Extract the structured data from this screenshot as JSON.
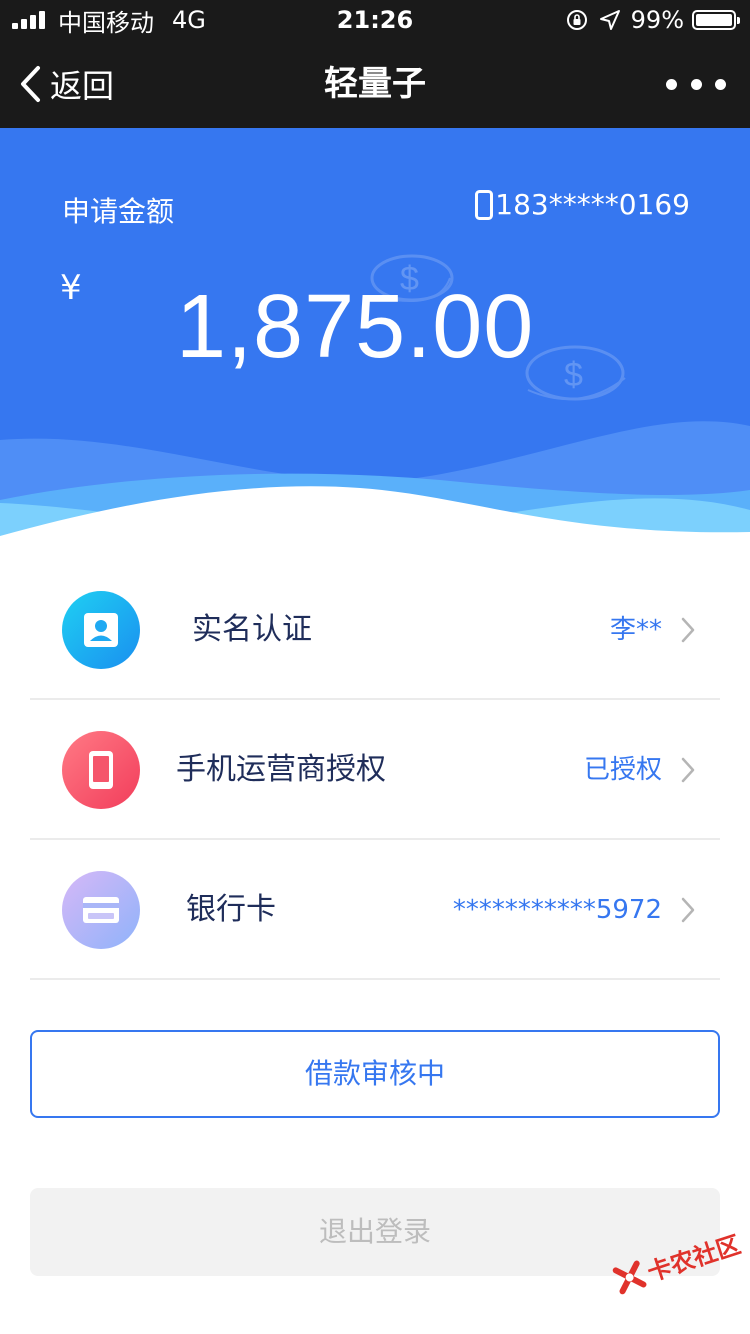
{
  "status_bar": {
    "carrier": "中国移动",
    "network": "4G",
    "time": "21:26",
    "battery": "99%",
    "battery_level": 0.99
  },
  "nav": {
    "back_label": "返回",
    "title": "轻量子"
  },
  "hero": {
    "label": "申请金额",
    "phone": "183*****0169",
    "currency": "¥",
    "amount": "1,875.00",
    "background_color": "#3677f0"
  },
  "list": {
    "items": [
      {
        "label": "实名认证",
        "value": "李**",
        "icon": "id-card-icon"
      },
      {
        "label": "手机运营商授权",
        "value": "已授权",
        "icon": "mobile-phone-icon"
      },
      {
        "label": "银行卡",
        "value": "***********5972",
        "icon": "bank-card-icon"
      }
    ]
  },
  "buttons": {
    "status_label": "借款审核中",
    "logout_label": "退出登录"
  },
  "watermark": {
    "text": "卡农社区"
  },
  "colors": {
    "accent": "#3677f0",
    "nav_background": "#1a1a1a",
    "label_text": "#1f2d5a",
    "disabled_text": "#bdbdbd"
  }
}
